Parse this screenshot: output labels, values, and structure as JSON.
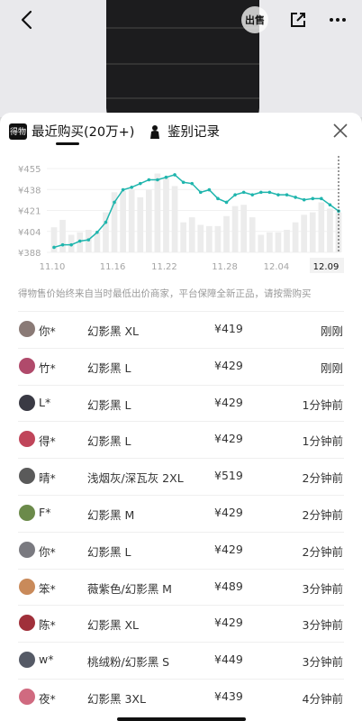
{
  "header": {
    "sell_badge": "出售"
  },
  "tabs": [
    {
      "label": "最近购买(20万+)",
      "logo": "得物"
    },
    {
      "label": "鉴别记录"
    }
  ],
  "chart_data": {
    "type": "line",
    "yticks": [
      "¥455",
      "¥438",
      "¥421",
      "¥404",
      "¥388"
    ],
    "xticks": [
      "11.10",
      "11.16",
      "11.22",
      "11.28",
      "12.04",
      "12.09"
    ],
    "selected_x": "12.09",
    "line_color": "#1fb5ad",
    "bar_color": "#ececec",
    "ylim": [
      388,
      455
    ],
    "line_values": [
      392,
      394,
      394,
      397,
      398,
      404,
      412,
      428,
      438,
      440,
      443,
      446,
      446,
      448,
      450,
      444,
      443,
      436,
      438,
      431,
      428,
      434,
      436,
      434,
      436,
      436,
      434,
      434,
      432,
      430,
      431,
      431,
      426,
      421
    ],
    "bar_values": [
      408,
      414,
      402,
      404,
      406,
      404,
      420,
      436,
      437,
      438,
      432,
      438,
      451,
      448,
      441,
      412,
      416,
      410,
      409,
      409,
      417,
      425,
      426,
      416,
      402,
      404,
      404,
      406,
      412,
      418,
      420,
      428,
      423,
      420
    ]
  },
  "note": "得物售价始终来自当时最低出价商家，平台保障全新正品，请按需购买",
  "records": [
    {
      "user": "你*",
      "item": "幻影黑 XL",
      "price": "¥419",
      "time": "刚刚",
      "avatar_color": "#8a7a76"
    },
    {
      "user": "竹*",
      "item": "幻影黑 L",
      "price": "¥429",
      "time": "刚刚",
      "avatar_color": "#b04a6b"
    },
    {
      "user": "L*",
      "item": "幻影黑 L",
      "price": "¥429",
      "time": "1分钟前",
      "avatar_color": "#3a3a44"
    },
    {
      "user": "得*",
      "item": "幻影黑 L",
      "price": "¥429",
      "time": "1分钟前",
      "avatar_color": "#c0455a"
    },
    {
      "user": "晴*",
      "item": "浅烟灰/深瓦灰 2XL",
      "price": "¥519",
      "time": "2分钟前",
      "avatar_color": "#5a5a5a"
    },
    {
      "user": "F*",
      "item": "幻影黑 M",
      "price": "¥429",
      "time": "2分钟前",
      "avatar_color": "#6b8a4a"
    },
    {
      "user": "你*",
      "item": "幻影黑 L",
      "price": "¥429",
      "time": "2分钟前",
      "avatar_color": "#7a7a80"
    },
    {
      "user": "笨*",
      "item": "薇紫色/幻影黑 M",
      "price": "¥489",
      "time": "3分钟前",
      "avatar_color": "#c98a5a"
    },
    {
      "user": "陈*",
      "item": "幻影黑 XL",
      "price": "¥429",
      "time": "3分钟前",
      "avatar_color": "#a0303a"
    },
    {
      "user": "w*",
      "item": "桃绒粉/幻影黑 S",
      "price": "¥449",
      "time": "3分钟前",
      "avatar_color": "#555a66"
    },
    {
      "user": "夜*",
      "item": "幻影黑 3XL",
      "price": "¥439",
      "time": "4分钟前",
      "avatar_color": "#d06a80"
    }
  ]
}
